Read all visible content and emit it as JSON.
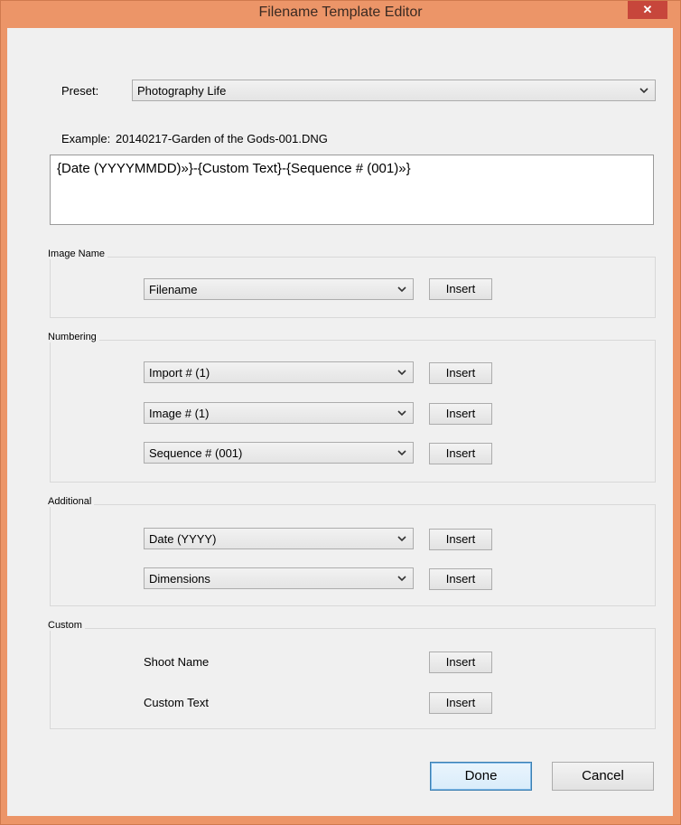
{
  "window": {
    "title": "Filename Template Editor",
    "close_label": "✕"
  },
  "preset": {
    "label": "Preset:",
    "value": "Photography Life"
  },
  "example": {
    "label": "Example:",
    "value": "20140217-Garden of the Gods-001.DNG"
  },
  "template_text": "{Date (YYYYMMDD)»}-{Custom Text}-{Sequence # (001)»}",
  "image_name": {
    "legend": "Image Name",
    "select_value": "Filename",
    "insert_label": "Insert"
  },
  "numbering": {
    "legend": "Numbering",
    "rows": [
      {
        "value": "Import # (1)",
        "insert_label": "Insert"
      },
      {
        "value": "Image # (1)",
        "insert_label": "Insert"
      },
      {
        "value": "Sequence # (001)",
        "insert_label": "Insert"
      }
    ]
  },
  "additional": {
    "legend": "Additional",
    "rows": [
      {
        "value": "Date (YYYY)",
        "insert_label": "Insert"
      },
      {
        "value": "Dimensions",
        "insert_label": "Insert"
      }
    ]
  },
  "custom": {
    "legend": "Custom",
    "rows": [
      {
        "label": "Shoot Name",
        "insert_label": "Insert"
      },
      {
        "label": "Custom Text",
        "insert_label": "Insert"
      }
    ]
  },
  "footer": {
    "done_label": "Done",
    "cancel_label": "Cancel"
  },
  "icons": {
    "dropdown": "chevron-down-icon",
    "close": "close-icon"
  },
  "colors": {
    "title_bar": "#ec9568",
    "close_button": "#c7463b",
    "dialog_bg": "#f0f0f0"
  }
}
